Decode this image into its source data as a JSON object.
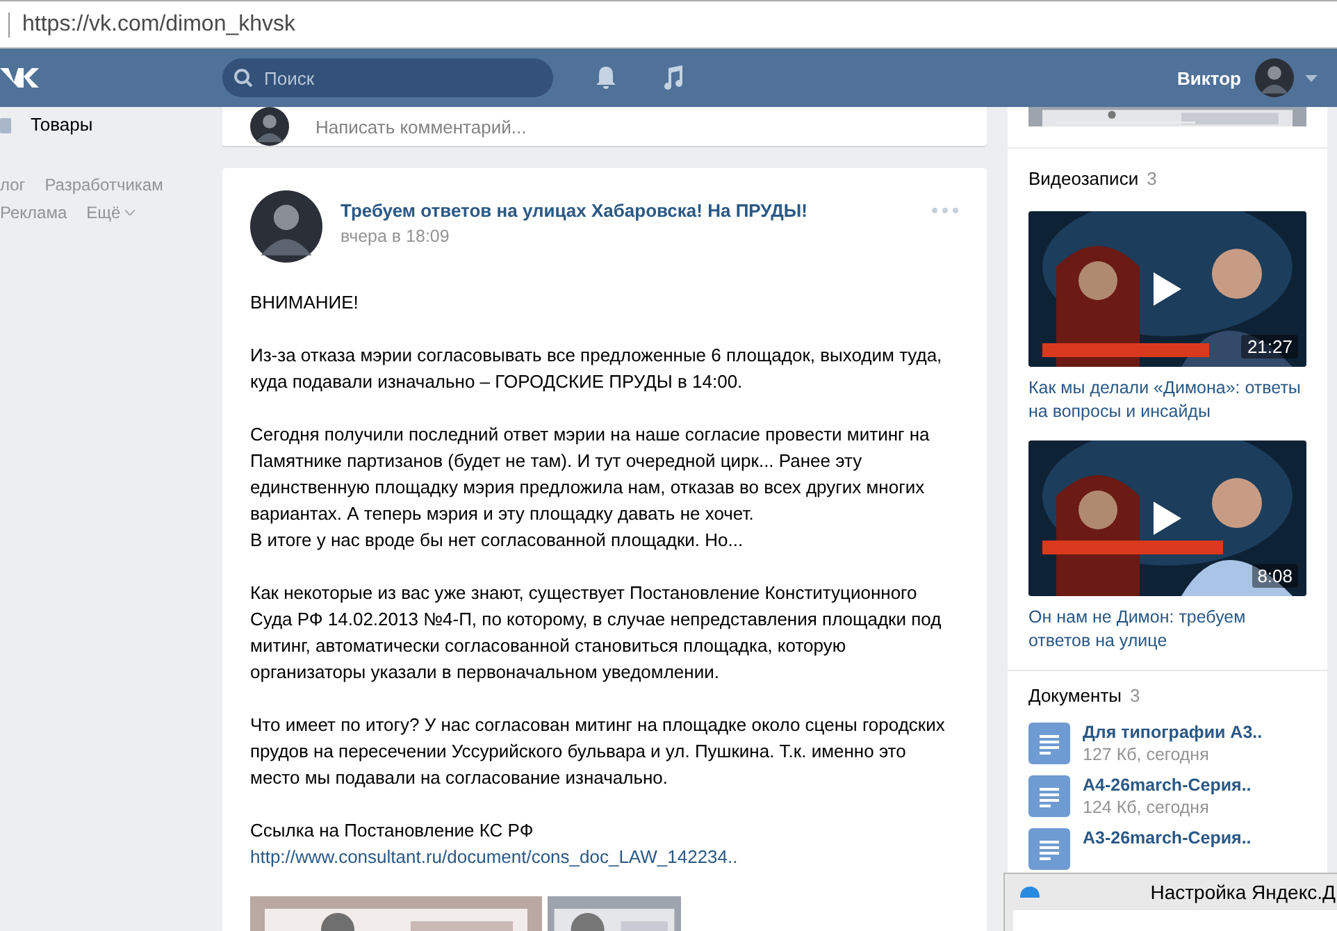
{
  "browser": {
    "url": "https://vk.com/dimon_khvsk"
  },
  "header": {
    "search": {
      "placeholder": "Поиск"
    },
    "user_name": "Виктор"
  },
  "sidebar": {
    "items": [
      {
        "label": "Товары"
      }
    ],
    "footer_links": [
      "лог",
      "Разработчикам",
      "Реклама",
      "Ещё"
    ]
  },
  "comment_box": {
    "placeholder": "Написать комментарий..."
  },
  "post": {
    "title": "Требуем ответов на улицах Хабаровска! На ПРУДЫ!",
    "date": "вчера в 18:09",
    "paragraphs": [
      [
        "ВНИМАНИЕ!"
      ],
      [
        "Из-за отказа мэрии согласовывать все предложенные 6 площадок, выходим туда,",
        "куда подавали изначально – ГОРОДСКИЕ ПРУДЫ в 14:00."
      ],
      [
        "Сегодня получили последний ответ мэрии на наше согласие провести митинг на",
        "Памятнике партизанов (будет не там). И тут очередной цирк... Ранее эту",
        "единственную площадку мэрия предложила нам, отказав во всех других многих",
        "вариантах. А теперь мэрия и эту площадку давать не хочет.",
        "В итоге у нас вроде бы нет согласованной площадки. Но..."
      ],
      [
        "Как некоторые из вас уже знают, существует Постановление Конституционного",
        "Суда РФ 14.02.2013 №4-П, по которому, в случае непредставления площадки под",
        "митинг, автоматически согласованной становиться площадка, которую",
        "организаторы указали в первоначальном уведомлении."
      ],
      [
        "Что имеет по итогу? У нас согласован митинг на площадке около сцены городских",
        "прудов на пересечении Уссурийского бульвара и ул. Пушкина. Т.к. именно это",
        "место мы подавали на согласование изначально."
      ],
      [
        "Ссылка на Постановление КС РФ"
      ]
    ],
    "link": "http://www.consultant.ru/document/cons_doc_LAW_142234..",
    "attachments": [
      {
        "kind": "picture"
      },
      {
        "kind": "picture"
      }
    ]
  },
  "videos": {
    "title": "Видеозаписи",
    "count": "3",
    "items": [
      {
        "duration": "21:27",
        "title": "Как мы делали «Димона»: ответы на вопросы и инсайды"
      },
      {
        "duration": "8:08",
        "title": "Он нам не Димон: требуем ответов на улице"
      }
    ]
  },
  "documents": {
    "title": "Документы",
    "count": "3",
    "items": [
      {
        "name": "Для типографии А3..",
        "meta": "127 Кб, сегодня"
      },
      {
        "name": "А4-26march-Серия..",
        "meta": "124 Кб, сегодня"
      },
      {
        "name": "А3-26march-Серия.."
      }
    ]
  },
  "dialog": {
    "title": "Настройка Яндекс.Д"
  }
}
